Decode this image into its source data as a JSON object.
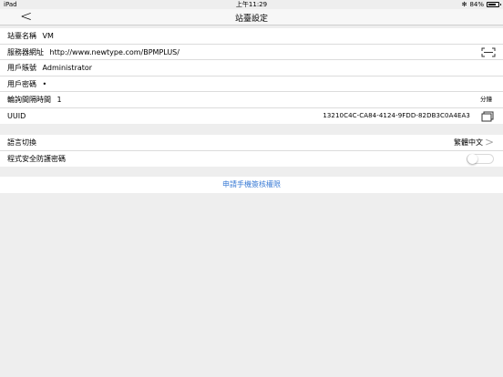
{
  "status_bar": {
    "device": "iPad",
    "time": "上午11:29",
    "battery_text": "84%",
    "battery_level": 0.84
  },
  "nav": {
    "back_icon": "chevron-left-icon",
    "title": "站臺設定"
  },
  "settings": {
    "site_name": {
      "label": "站臺名稱",
      "value": "VM"
    },
    "server_url": {
      "label": "服務器網址",
      "value": "http://www.newtype.com/BPMPLUS/"
    },
    "account": {
      "label": "用戶賬號",
      "value": "Administrator"
    },
    "password": {
      "label": "用戶密碼",
      "value": "•"
    },
    "poll_interval": {
      "label": "輪詢間隔時間",
      "value": "1",
      "unit": "分鐘"
    },
    "uuid": {
      "label": "UUID",
      "value": "13210C4C-CA84-4124-9FDD-82DB3C0A4EA3"
    }
  },
  "preferences": {
    "language": {
      "label": "語言切換",
      "value": "繁體中文"
    },
    "app_lock": {
      "label": "程式安全防護密碼",
      "enabled": false
    }
  },
  "apply_link": "申請手機簽核權限",
  "colors": {
    "background": "#eeeeee",
    "link": "#3a7bd5"
  }
}
